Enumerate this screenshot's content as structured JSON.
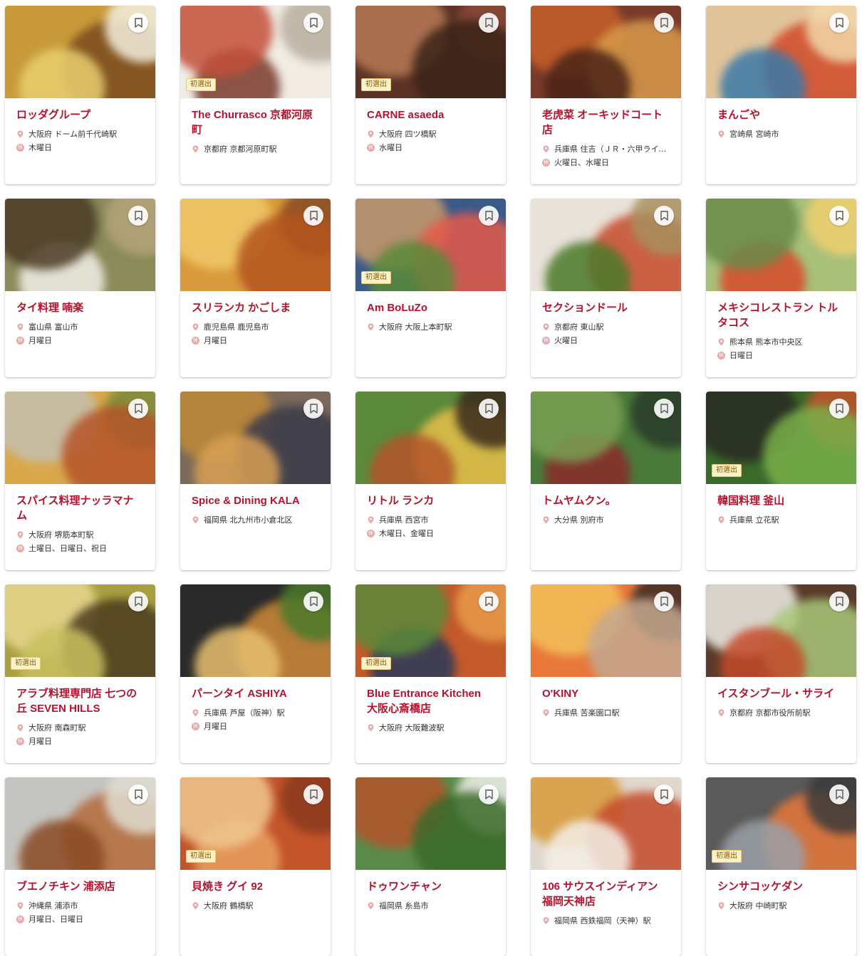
{
  "restaurants": [
    {
      "name": "ロッダグループ",
      "location": "大阪府 ドーム前千代崎駅",
      "closed": "木曜日",
      "new": false,
      "colors": [
        "#c99a3a",
        "#7a4a1e",
        "#e8d070",
        "#f4f0e0"
      ]
    },
    {
      "name": "The Churrasco 京都河原町",
      "location": "京都府 京都河原町駅",
      "closed": "",
      "new": true,
      "colors": [
        "#f1ece4",
        "#7a3a2c",
        "#b9b0a0",
        "#c4503a"
      ]
    },
    {
      "name": "CARNE asaeda",
      "location": "大阪府 四ツ橋駅",
      "closed": "水曜日",
      "new": true,
      "colors": [
        "#5a3226",
        "#8a4a3a",
        "#b77a55",
        "#3a2418"
      ]
    },
    {
      "name": "老虎菜 オーキッドコート店",
      "location": "兵庫県 住吉（ＪＲ・六甲ライナー）駅",
      "closed": "火曜日、水曜日",
      "new": false,
      "colors": [
        "#7a3a2a",
        "#c6602a",
        "#d89a4a",
        "#4a2418"
      ]
    },
    {
      "name": "まんごや",
      "location": "宮崎県 宮崎市",
      "closed": "",
      "new": false,
      "colors": [
        "#e2c49a",
        "#d04a2a",
        "#3a7aa8",
        "#f2d8a8"
      ]
    },
    {
      "name": "タイ料理 喃楽",
      "location": "富山県 富山市",
      "closed": "月曜日",
      "new": false,
      "colors": [
        "#8a8a5a",
        "#f2f0e8",
        "#b4a47a",
        "#4a3a24"
      ]
    },
    {
      "name": "スリランカ かごしま",
      "location": "鹿児島県 鹿児島市",
      "closed": "月曜日",
      "new": false,
      "colors": [
        "#d89a3a",
        "#8a4a24",
        "#f0c86a",
        "#b4541e"
      ]
    },
    {
      "name": "Am BoLuZo",
      "location": "大阪府 大阪上本町駅",
      "closed": "",
      "new": true,
      "colors": [
        "#3a5a8a",
        "#c99a6a",
        "#e65a4a",
        "#5a8a3a"
      ]
    },
    {
      "name": "セクションドール",
      "location": "京都府 東山駅",
      "closed": "火曜日",
      "new": false,
      "colors": [
        "#e8e2d8",
        "#c64a2a",
        "#4a7a2a",
        "#a89060"
      ]
    },
    {
      "name": "メキシコレストラン トルタコス",
      "location": "熊本県 熊本市中央区",
      "closed": "日曜日",
      "new": false,
      "colors": [
        "#a8c07a",
        "#d84a2a",
        "#f0d070",
        "#6a8a4a"
      ]
    },
    {
      "name": "スパイス料理ナッラマナム",
      "location": "大阪府 堺筋本町駅",
      "closed": "土曜日、日曜日、祝日",
      "new": false,
      "colors": [
        "#d8a84a",
        "#7a8a3a",
        "#c4c0b0",
        "#b4542a"
      ]
    },
    {
      "name": "Spice & Dining KALA",
      "location": "福岡県 北九州市小倉北区",
      "closed": "",
      "new": false,
      "colors": [
        "#7a6a5a",
        "#c08a3a",
        "#3a3a4a",
        "#d8a054"
      ]
    },
    {
      "name": "リトル ランカ",
      "location": "兵庫県 西宮市",
      "closed": "木曜日、金曜日",
      "new": false,
      "colors": [
        "#5a8a3a",
        "#e8c04a",
        "#b4542a",
        "#3a2a1e"
      ]
    },
    {
      "name": "トムヤムクン。",
      "location": "大分県 別府市",
      "closed": "",
      "new": false,
      "colors": [
        "#4a7a3a",
        "#8a2a2a",
        "#2a3a2a",
        "#7aa054"
      ]
    },
    {
      "name": "韓国料理 釜山",
      "location": "兵庫県 立花駅",
      "closed": "",
      "new": true,
      "colors": [
        "#3a6a2a",
        "#c4542a",
        "#2a2a24",
        "#7ab04a"
      ]
    },
    {
      "name": "アラブ料理専門店 七つの丘 SEVEN HILLS",
      "location": "大阪府 南森町駅",
      "closed": "月曜日",
      "new": true,
      "colors": [
        "#a8a040",
        "#e8d890",
        "#4a3a1e",
        "#c8c060"
      ]
    },
    {
      "name": "パーンタイ ASHIYA",
      "location": "兵庫県 芦屋（阪神）駅",
      "closed": "月曜日",
      "new": false,
      "colors": [
        "#2a2a2a",
        "#d08a3a",
        "#e8c070",
        "#4a7a2a"
      ]
    },
    {
      "name": "Blue Entrance Kitchen 大阪心斎橋店",
      "location": "大阪府 大阪難波駅",
      "closed": "",
      "new": true,
      "colors": [
        "#c45a2a",
        "#2a3a5a",
        "#e89a4a",
        "#5a8a3a"
      ]
    },
    {
      "name": "O'KINY",
      "location": "兵庫県 苦楽園口駅",
      "closed": "",
      "new": false,
      "colors": [
        "#e8783a",
        "#3a2a24",
        "#f4c05a",
        "#c4a890"
      ]
    },
    {
      "name": "イスタンブール・サライ",
      "location": "京都府 京都市役所前駅",
      "closed": "",
      "new": false,
      "colors": [
        "#5a3a2a",
        "#f0f0e8",
        "#a8c87a",
        "#c44a2a"
      ]
    },
    {
      "name": "ブエノチキン 浦添店",
      "location": "沖縄県 浦添市",
      "closed": "月曜日、日曜日",
      "new": false,
      "colors": [
        "#c4c4c0",
        "#b46a3a",
        "#8a4a24",
        "#e0ddd0"
      ]
    },
    {
      "name": "貝焼き グイ 92",
      "location": "大阪府 鶴橋駅",
      "closed": "",
      "new": true,
      "colors": [
        "#c4542a",
        "#e8a060",
        "#8a3a1e",
        "#f0c890"
      ]
    },
    {
      "name": "ドゥワンチャン",
      "location": "福岡県 糸島市",
      "closed": "",
      "new": false,
      "colors": [
        "#5a8a4a",
        "#f0f0ea",
        "#b4542a",
        "#3a6a2a"
      ]
    },
    {
      "name": "106 サウスインディアン 福岡天神店",
      "location": "福岡県 西鉄福岡（天神）駅",
      "closed": "",
      "new": false,
      "colors": [
        "#e0d8cc",
        "#d89a3a",
        "#c44a2a",
        "#f4f0e8"
      ]
    },
    {
      "name": "シンサコッケダン",
      "location": "大阪府 中崎町駅",
      "closed": "",
      "new": true,
      "colors": [
        "#5a5a5a",
        "#e8783a",
        "#9aa0a8",
        "#3a3a3a"
      ]
    }
  ],
  "badge_label": "初選出",
  "closed_icon_char": "休",
  "accent_color": "#b5122e"
}
